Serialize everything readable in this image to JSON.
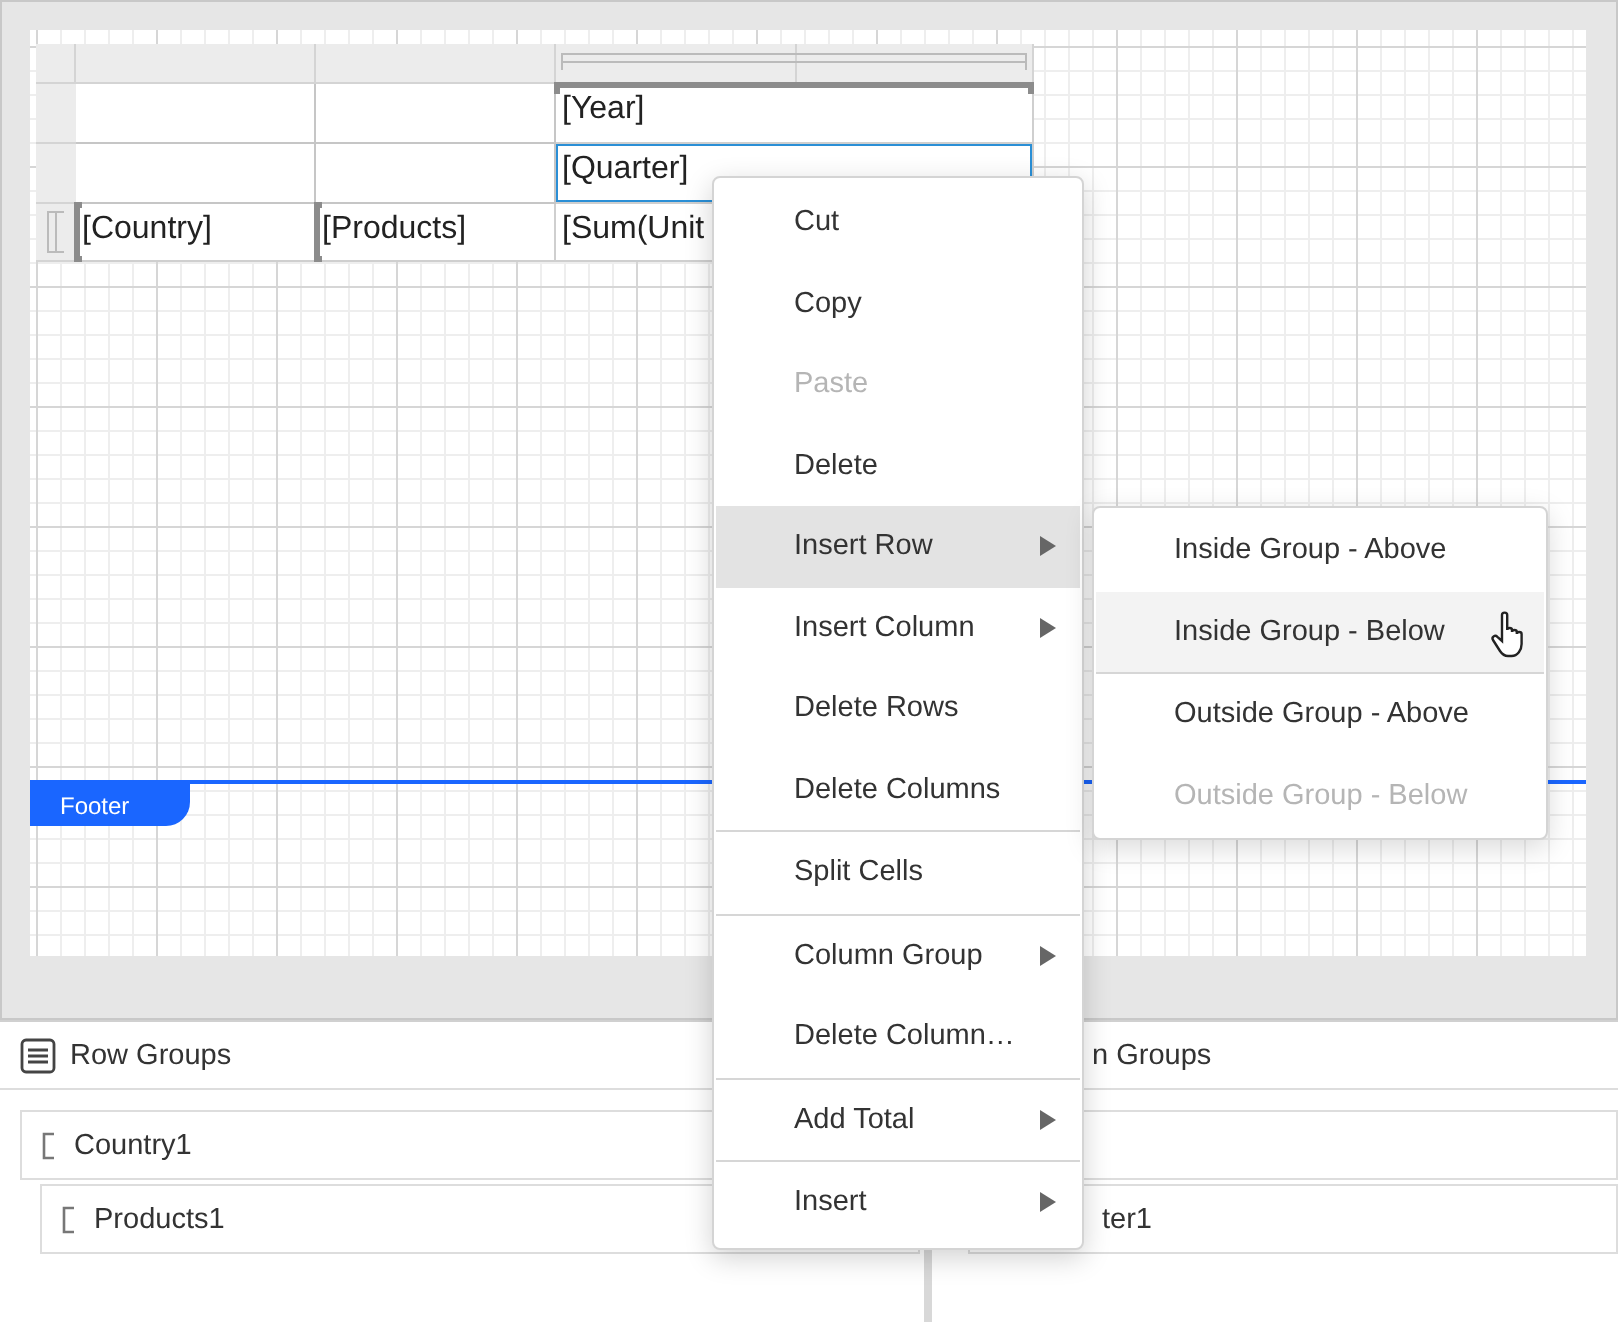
{
  "table": {
    "rows": [
      {
        "handle": false,
        "cells": [
          {
            "text": "[Year]",
            "selected": false,
            "group_marker": true
          }
        ]
      },
      {
        "handle": false,
        "cells": [
          {
            "text": "[Quarter]",
            "selected": true,
            "group_marker": false
          }
        ]
      },
      {
        "handle": true,
        "cells": [
          {
            "text": "[Country]",
            "selected": false,
            "group_marker": true
          },
          {
            "text": "[Products]",
            "selected": false,
            "group_marker": true
          },
          {
            "text": "[Sum(Unit",
            "selected": false,
            "group_marker": false
          }
        ]
      }
    ]
  },
  "footer": {
    "label": "Footer"
  },
  "context_menu": {
    "items": [
      {
        "label": "Cut",
        "disabled": false,
        "selected": false,
        "submenu": false,
        "separator_before": false
      },
      {
        "label": "Copy",
        "disabled": false,
        "selected": false,
        "submenu": false,
        "separator_before": false
      },
      {
        "label": "Paste",
        "disabled": true,
        "selected": false,
        "submenu": false,
        "separator_before": false
      },
      {
        "label": "Delete",
        "disabled": false,
        "selected": false,
        "submenu": false,
        "separator_before": false
      },
      {
        "label": "Insert Row",
        "disabled": false,
        "selected": true,
        "submenu": true,
        "separator_before": false
      },
      {
        "label": "Insert Column",
        "disabled": false,
        "selected": false,
        "submenu": true,
        "separator_before": false
      },
      {
        "label": "Delete Rows",
        "disabled": false,
        "selected": false,
        "submenu": false,
        "separator_before": false
      },
      {
        "label": "Delete Columns",
        "disabled": false,
        "selected": false,
        "submenu": false,
        "separator_before": false
      },
      {
        "label": "Split Cells",
        "disabled": false,
        "selected": false,
        "submenu": false,
        "separator_before": true
      },
      {
        "label": "Column Group",
        "disabled": false,
        "selected": false,
        "submenu": true,
        "separator_before": true
      },
      {
        "label": "Delete Column…",
        "disabled": false,
        "selected": false,
        "submenu": false,
        "separator_before": false
      },
      {
        "label": "Add Total",
        "disabled": false,
        "selected": false,
        "submenu": true,
        "separator_before": true
      },
      {
        "label": "Insert",
        "disabled": false,
        "selected": false,
        "submenu": true,
        "separator_before": true
      }
    ]
  },
  "submenu": {
    "items": [
      {
        "label": "Inside Group - Above",
        "disabled": false,
        "selected": false,
        "separator_before": false
      },
      {
        "label": "Inside Group - Below",
        "disabled": false,
        "selected": true,
        "separator_before": false
      },
      {
        "label": "Outside Group - Above",
        "disabled": false,
        "selected": false,
        "separator_before": true
      },
      {
        "label": "Outside Group - Below",
        "disabled": true,
        "selected": false,
        "separator_before": false
      }
    ]
  },
  "row_groups": {
    "title": "Row Groups",
    "items": [
      {
        "label": "Country1",
        "children": [
          {
            "label": "Products1"
          }
        ]
      }
    ]
  },
  "column_groups": {
    "title": "n Groups",
    "items": [
      {
        "children": [
          {
            "label": "ter1"
          }
        ]
      }
    ]
  }
}
